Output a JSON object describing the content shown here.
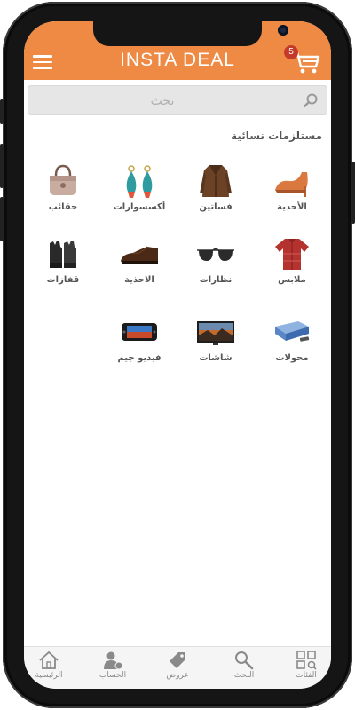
{
  "header": {
    "brand": "INSTA DEAL",
    "cart_count": "5"
  },
  "search": {
    "placeholder": "بحث"
  },
  "section": {
    "title": "مستلزمات نسائية"
  },
  "categories": [
    {
      "label": "الأحذية",
      "icon": "women-heels-icon"
    },
    {
      "label": "فساتين",
      "icon": "coat-dress-icon"
    },
    {
      "label": "أكسسوارات",
      "icon": "earrings-icon"
    },
    {
      "label": "حقائب",
      "icon": "handbag-icon"
    },
    {
      "label": "ملابس",
      "icon": "shirt-icon"
    },
    {
      "label": "نظارات",
      "icon": "sunglasses-icon"
    },
    {
      "label": "الاحذية",
      "icon": "men-shoe-icon"
    },
    {
      "label": "قفازات",
      "icon": "gloves-icon"
    },
    {
      "label": "محولات",
      "icon": "receiver-icon"
    },
    {
      "label": "شاشات",
      "icon": "tv-screen-icon"
    },
    {
      "label": "فيديو جيم",
      "icon": "game-console-icon"
    }
  ],
  "bottom_nav": [
    {
      "label": "الفئات",
      "icon": "categories-grid-icon"
    },
    {
      "label": "البحث",
      "icon": "search-icon"
    },
    {
      "label": "عروض",
      "icon": "tag-icon"
    },
    {
      "label": "الحساب",
      "icon": "account-icon"
    },
    {
      "label": "الرئيسية",
      "icon": "home-icon"
    }
  ],
  "colors": {
    "accent": "#ee8a44",
    "badge": "#c43a2a"
  }
}
